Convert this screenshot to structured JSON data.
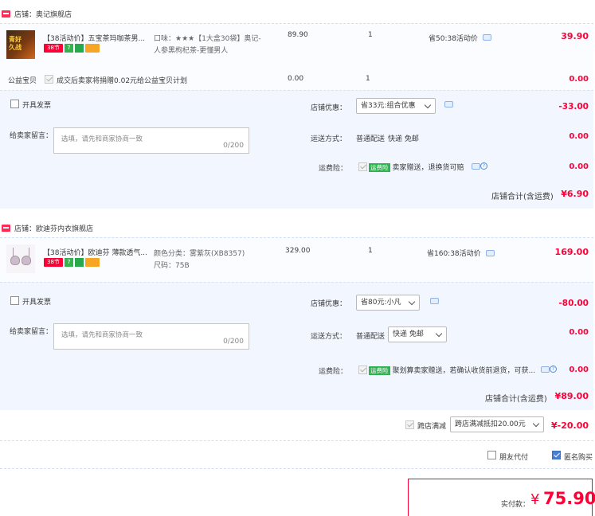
{
  "shops": [
    {
      "name": "店铺：奥记旗舰店",
      "item": {
        "title": "【38活动价】五宝茶玛咖茶男...",
        "attr1": "口味：★★★【1大盒30袋】奥记-",
        "attr2": "人参黑枸杞茶-更懂男人",
        "unit_price": "89.90",
        "qty": "1",
        "promo": "省50:38活动价",
        "total": "39.90",
        "thumb_text": "青好\n久战",
        "tags": [
          "38节",
          "7",
          "",
          ""
        ]
      },
      "charity": {
        "label": "公益宝贝",
        "desc": "成交后卖家将捐赠0.02元给公益宝贝计划",
        "price": "0.00",
        "qty": "1",
        "total": "0.00"
      },
      "invoice_label": "开具发票",
      "message_label": "给卖家留言：",
      "message_placeholder": "选填，请先和商家协商一致",
      "message_count": "0/200",
      "discount_label": "店铺优惠：",
      "discount_value": "省33元:组合优惠",
      "discount_amount": "-33.00",
      "shipping_label": "运送方式：",
      "shipping_method": "普通配送",
      "shipping_option": "快递 免邮",
      "shipping_amount": "0.00",
      "insurance_label": "运费险：",
      "insurance_tag": "运费险",
      "insurance_desc": "卖家赠送，退换货可赔",
      "insurance_amount": "0.00",
      "subtotal_label": "店铺合计(含运费)",
      "subtotal": "¥6.90"
    },
    {
      "name": "店铺：欧迪芬内衣旗舰店",
      "item": {
        "title": "【38活动价】欧迪芬 薄款透气...",
        "attr1": "颜色分类：雾紫灰(XB8357)",
        "attr2": "尺码：75B",
        "unit_price": "329.00",
        "qty": "1",
        "promo": "省160:38活动价",
        "total": "169.00",
        "tags": [
          "38节",
          "7",
          "",
          ""
        ]
      },
      "invoice_label": "开具发票",
      "message_label": "给卖家留言：",
      "message_placeholder": "选填，请先和商家协商一致",
      "message_count": "0/200",
      "discount_label": "店铺优惠：",
      "discount_value": "省80元:小凡",
      "discount_amount": "-80.00",
      "shipping_label": "运送方式：",
      "shipping_method": "普通配送",
      "shipping_option": "快递 免邮",
      "shipping_amount": "0.00",
      "insurance_label": "运费险：",
      "insurance_tag": "运费险",
      "insurance_desc": "聚划算卖家赠送，若确认收货前退货，可获...",
      "insurance_amount": "0.00",
      "subtotal_label": "店铺合计(含运费)",
      "subtotal": "¥89.00"
    }
  ],
  "cross_store": {
    "label": "跨店满减",
    "value": "跨店满减抵扣20.00元",
    "amount": "¥-20.00"
  },
  "friend_pay_label": "朋友代付",
  "anon_label": "匿名购买",
  "pay": {
    "label": "实付款：",
    "currency": "¥",
    "amount": "75.90"
  },
  "colors": {
    "accent": "#ff0036",
    "green": "#2fb350",
    "blue_bg": "#f2f7ff"
  }
}
